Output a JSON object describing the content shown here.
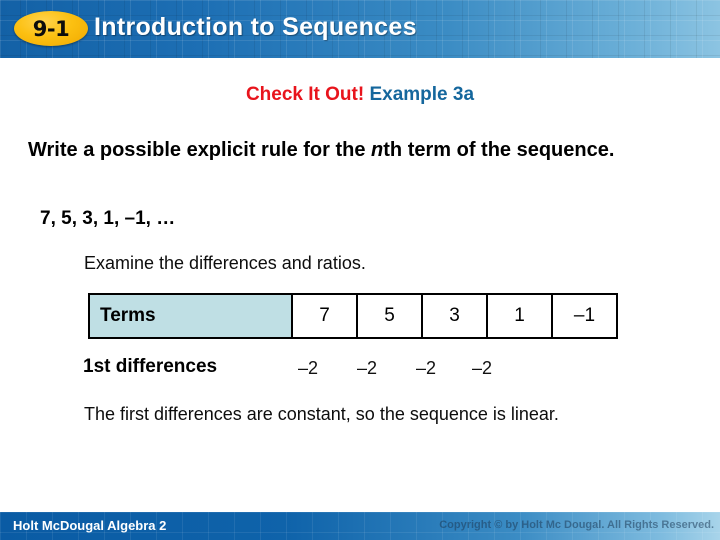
{
  "header": {
    "badge_label": "9-1",
    "title": "Introduction to Sequences",
    "badge_color": "#fcc011",
    "bar_color": "#1d6fb4"
  },
  "slide": {
    "example_heading": {
      "callout": "Check It Out!",
      "callout_color": "#e8141c",
      "example_label": "Example 3a",
      "example_color": "#15679d"
    },
    "problem_statement": {
      "part1": "Write a possible explicit rule for the ",
      "italic_var": "n",
      "part2": "th term of the sequence."
    },
    "sequence": "7, 5, 3, 1, –1, …",
    "examine_note": "Examine the differences and ratios.",
    "terms_table": {
      "row_label": "Terms",
      "header_fill": "#bfdfe4",
      "values": [
        "7",
        "5",
        "3",
        "1",
        "–1"
      ]
    },
    "differences": {
      "label": "1st differences",
      "values": [
        "–2",
        "–2",
        "–2",
        "–2"
      ]
    },
    "conclusion": "The first differences are constant, so the sequence is linear."
  },
  "footer": {
    "book_title": "Holt McDougal Algebra 2",
    "copyright": "Copyright © by Holt Mc Dougal. All Rights Reserved."
  }
}
